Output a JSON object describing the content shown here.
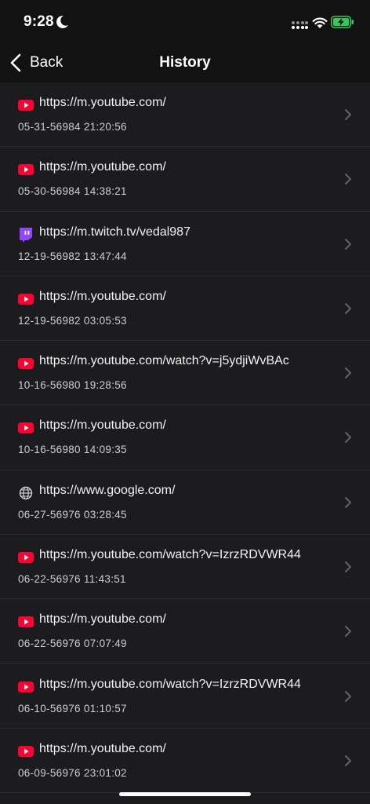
{
  "status_bar": {
    "time": "9:28"
  },
  "nav": {
    "back_label": "Back",
    "title": "History"
  },
  "colors": {
    "youtube_red": "#ff0033",
    "twitch_purple": "#9146ff",
    "background": "#1c1c1e",
    "bar_background": "#121212",
    "battery_green": "#34c759"
  },
  "history": [
    {
      "url": "https://m.youtube.com/",
      "date": "05-31-56984 21:20:56",
      "icon": "youtube-icon"
    },
    {
      "url": "https://m.youtube.com/",
      "date": "05-30-56984 14:38:21",
      "icon": "youtube-icon"
    },
    {
      "url": "https://m.twitch.tv/vedal987",
      "date": "12-19-56982 13:47:44",
      "icon": "twitch-icon"
    },
    {
      "url": "https://m.youtube.com/",
      "date": "12-19-56982 03:05:53",
      "icon": "youtube-icon"
    },
    {
      "url": "https://m.youtube.com/watch?v=j5ydjiWvBAc",
      "date": "10-16-56980 19:28:56",
      "icon": "youtube-icon"
    },
    {
      "url": "https://m.youtube.com/",
      "date": "10-16-56980 14:09:35",
      "icon": "youtube-icon"
    },
    {
      "url": "https://www.google.com/",
      "date": "06-27-56976 03:28:45",
      "icon": "globe-icon"
    },
    {
      "url": "https://m.youtube.com/watch?v=IzrzRDVWR44",
      "date": "06-22-56976 11:43:51",
      "icon": "youtube-icon"
    },
    {
      "url": "https://m.youtube.com/",
      "date": "06-22-56976 07:07:49",
      "icon": "youtube-icon"
    },
    {
      "url": "https://m.youtube.com/watch?v=IzrzRDVWR44",
      "date": "06-10-56976 01:10:57",
      "icon": "youtube-icon"
    },
    {
      "url": "https://m.youtube.com/",
      "date": "06-09-56976 23:01:02",
      "icon": "youtube-icon"
    }
  ]
}
